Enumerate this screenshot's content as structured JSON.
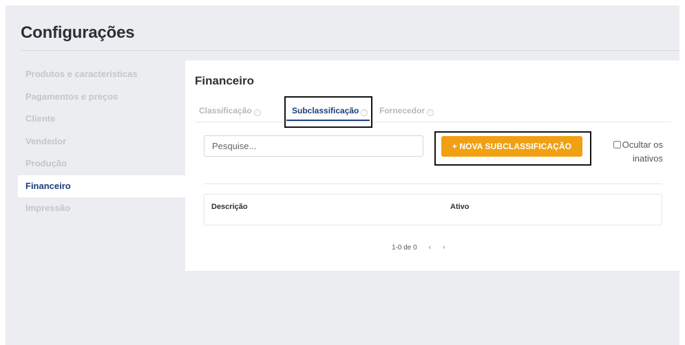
{
  "page": {
    "title": "Configurações"
  },
  "sidebar": {
    "items": [
      {
        "label": "Produtos e características"
      },
      {
        "label": "Pagamentos e preços"
      },
      {
        "label": "Cliente"
      },
      {
        "label": "Vendedor"
      },
      {
        "label": "Produção"
      },
      {
        "label": "Financeiro",
        "active": true
      },
      {
        "label": "Impressão"
      }
    ]
  },
  "section": {
    "title": "Financeiro"
  },
  "tabs": [
    {
      "label": "Classificação",
      "icon": "info-icon"
    },
    {
      "label": "Subclassificação",
      "icon": "info-icon",
      "active": true
    },
    {
      "label": "Fornecedor",
      "icon": "info-icon"
    }
  ],
  "search": {
    "placeholder": "Pesquise..."
  },
  "new_button": {
    "label": "+ NOVA SUBCLASSIFICAÇÃO"
  },
  "hide_inactive": {
    "label": "Ocultar os inativos",
    "checked": false
  },
  "table": {
    "columns": [
      "Descrição",
      "Ativo"
    ],
    "rows": []
  },
  "pagination": {
    "summary": "1-0 de 0",
    "prev": "‹",
    "next": "›"
  },
  "colors": {
    "accent": "#f0a012",
    "brand": "#1a3f78",
    "background": "#ecedf0"
  }
}
